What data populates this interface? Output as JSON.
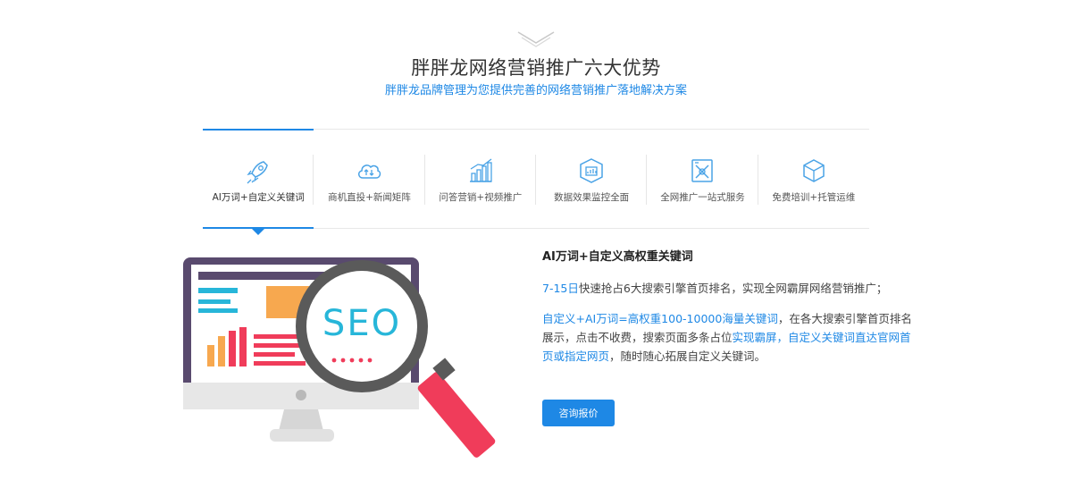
{
  "section": {
    "title": "胖胖龙网络营销推广六大优势",
    "subtitle": "胖胖龙品牌管理为您提供完善的网络营销推广落地解决方案"
  },
  "tabs": [
    {
      "label": "AI万词+自定义关键词",
      "icon": "rocket-icon",
      "active": true
    },
    {
      "label": "商机直投+新闻矩阵",
      "icon": "cloud-sync-icon",
      "active": false
    },
    {
      "label": "问答营销+视频推广",
      "icon": "bar-chart-icon",
      "active": false
    },
    {
      "label": "数据效果监控全面",
      "icon": "monitor-chart-icon",
      "active": false
    },
    {
      "label": "全网推广一站式服务",
      "icon": "tools-icon",
      "active": false
    },
    {
      "label": "免费培训+托管运维",
      "icon": "cube-icon",
      "active": false
    }
  ],
  "content": {
    "title": "AI万词+自定义高权重关键词",
    "p1_highlight": "7-15日",
    "p1_text": "快速抢占6大搜索引擎首页排名，实现全网霸屏网络营销推广；",
    "p2_highlight1": "自定义+AI万词=高权重100-10000海量关键词",
    "p2_text1": "，在各大搜索引擎首页排名展示，点击不收费，搜索页面多条占位",
    "p2_highlight2": "实现霸屏，自定义关键词直达官网首页或指定网页",
    "p2_text2": "，随时随心拓展自定义关键词。",
    "cta_label": "咨询报价"
  },
  "illustration": {
    "seo_text": "SEO"
  },
  "colors": {
    "accent": "#1e88e5",
    "icon": "#4aa3e6",
    "magnifier_handle": "#f03c5a",
    "monitor_frame": "#594a6e"
  }
}
